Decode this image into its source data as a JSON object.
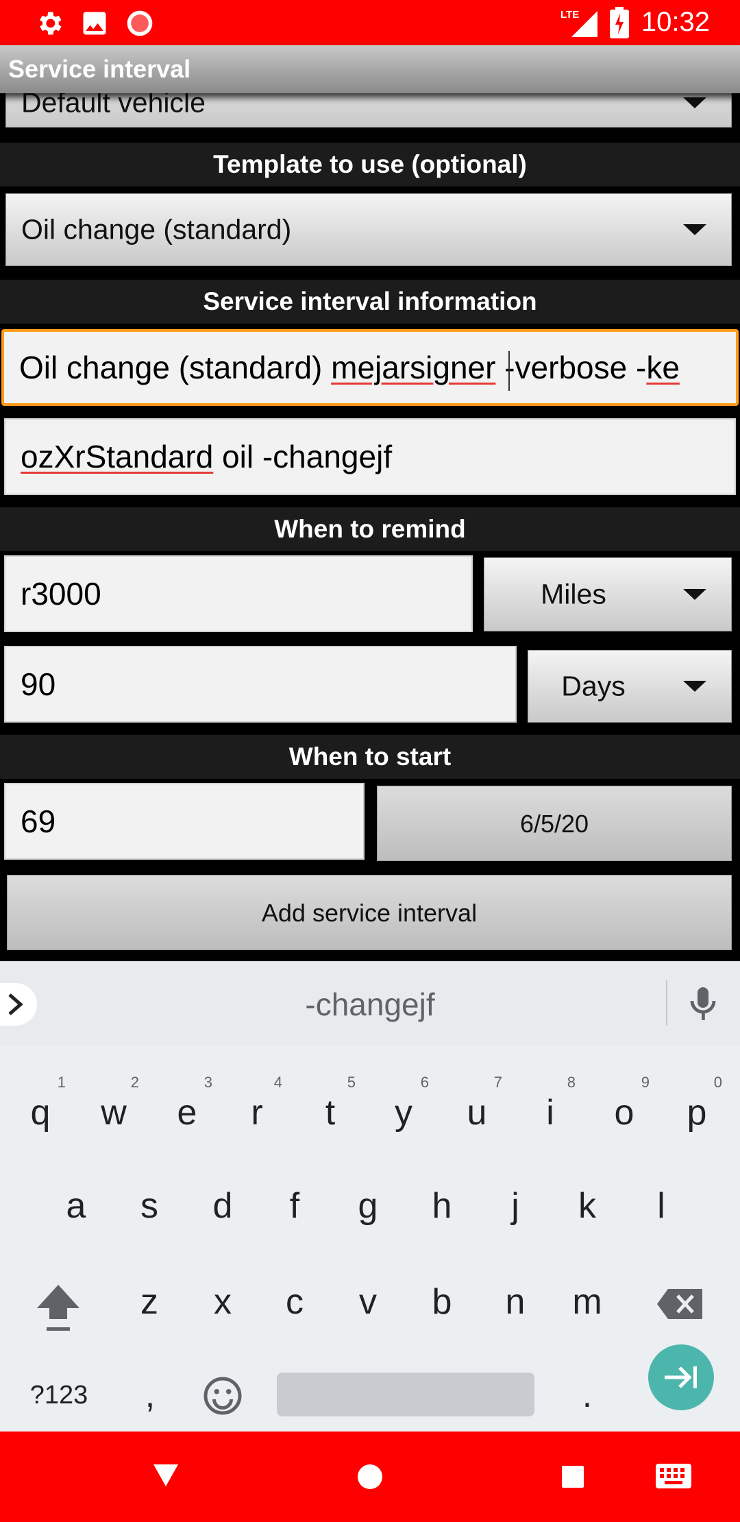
{
  "status_bar": {
    "time": "10:32",
    "network": "LTE"
  },
  "app_bar": {
    "title": "Service interval"
  },
  "vehicle_spinner": {
    "value": "Default vehicle"
  },
  "template_section": {
    "heading": "Template to use (optional)",
    "selected": "Oil change (standard)"
  },
  "info_section": {
    "heading": "Service interval information",
    "name_parts": [
      "Oil change (standard) ",
      "mejarsigner",
      " -verbose -",
      "ke"
    ],
    "description_parts": [
      "ozXrStandard",
      " oil -changejf"
    ]
  },
  "remind_section": {
    "heading": "When to remind",
    "distance_value": "r3000",
    "distance_unit": "Miles",
    "time_value": "90",
    "time_unit": "Days"
  },
  "start_section": {
    "heading": "When to start",
    "odometer_value": "69",
    "date_button": "6/5/20"
  },
  "add_button": "Add service interval",
  "keyboard": {
    "suggestion": "-changejf",
    "row1": [
      "q",
      "w",
      "e",
      "r",
      "t",
      "y",
      "u",
      "i",
      "o",
      "p"
    ],
    "row1_hints": [
      "1",
      "2",
      "3",
      "4",
      "5",
      "6",
      "7",
      "8",
      "9",
      "0"
    ],
    "row2": [
      "a",
      "s",
      "d",
      "f",
      "g",
      "h",
      "j",
      "k",
      "l"
    ],
    "row3": [
      "z",
      "x",
      "c",
      "v",
      "b",
      "n",
      "m"
    ],
    "symbols_key": "?123",
    "comma_key": ",",
    "period_key": "."
  },
  "colors": {
    "status_bar": "#ff0000",
    "focus": "#ff9a1a",
    "enter_key": "#4db6ac"
  }
}
